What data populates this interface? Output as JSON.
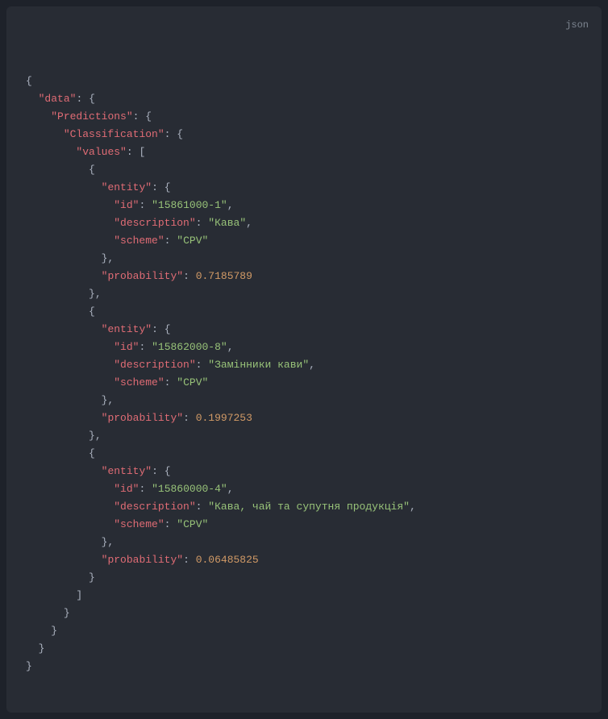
{
  "langLabel": "json",
  "topKey": "data",
  "predictionsKey": "Predictions",
  "classificationKey": "Classification",
  "valuesKey": "values",
  "entityKey": "entity",
  "idKey": "id",
  "descriptionKey": "description",
  "schemeKey": "scheme",
  "probabilityKey": "probability",
  "items": [
    {
      "id": "15861000-1",
      "description": "Кава",
      "scheme": "CPV",
      "probability": 0.7185789
    },
    {
      "id": "15862000-8",
      "description": "Замінники кави",
      "scheme": "CPV",
      "probability": 0.1997253
    },
    {
      "id": "15860000-4",
      "description": "Кава, чай та супутня продукція",
      "scheme": "CPV",
      "probability": 0.06485825
    }
  ],
  "chart_data": {
    "type": "table",
    "title": "Predictions / Classification",
    "columns": [
      "id",
      "description",
      "scheme",
      "probability"
    ],
    "rows": [
      [
        "15861000-1",
        "Кава",
        "CPV",
        0.7185789
      ],
      [
        "15862000-8",
        "Замінники кави",
        "CPV",
        0.1997253
      ],
      [
        "15860000-4",
        "Кава, чай та супутня продукція",
        "CPV",
        0.06485825
      ]
    ]
  }
}
